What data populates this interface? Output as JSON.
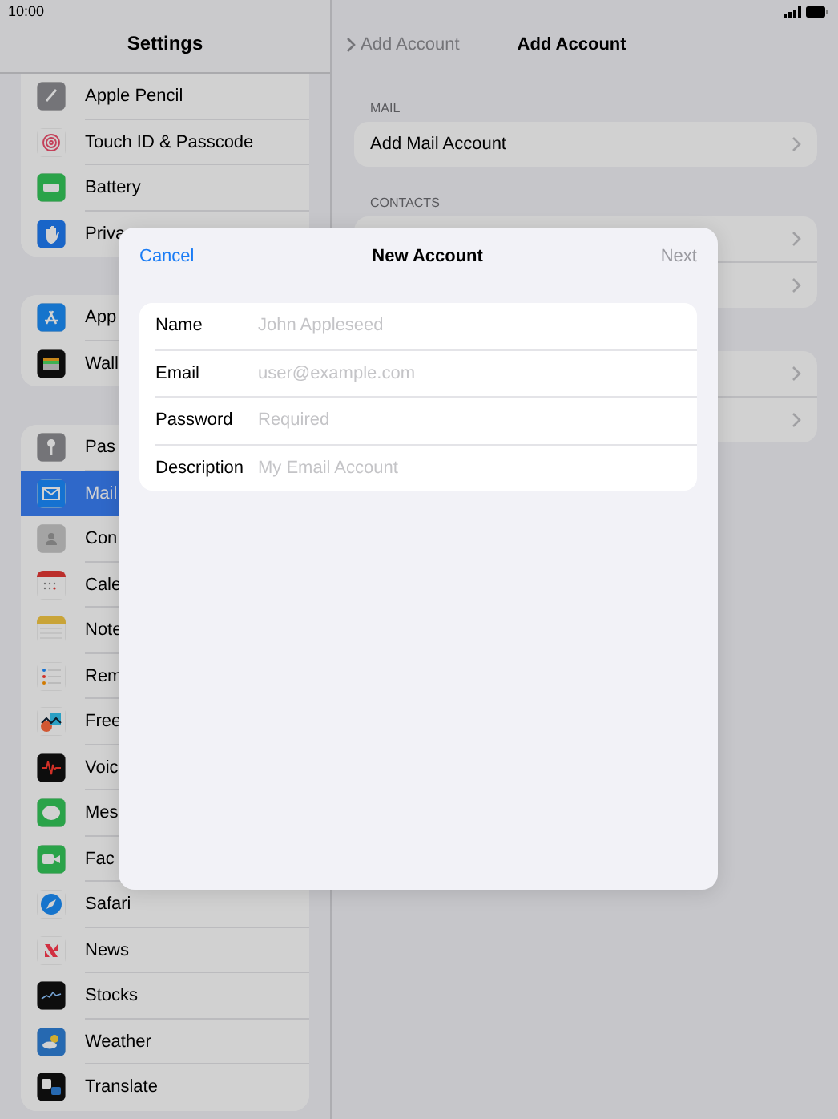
{
  "status_bar": {
    "time": "10:00"
  },
  "sidebar": {
    "title": "Settings",
    "groups": [
      {
        "items": [
          {
            "label": "Apple Pencil",
            "selected": false
          },
          {
            "label": "Touch ID & Passcode",
            "selected": false
          },
          {
            "label": "Battery",
            "selected": false
          },
          {
            "label": "Priva",
            "selected": false
          }
        ]
      },
      {
        "items": [
          {
            "label": "App",
            "selected": false
          },
          {
            "label": "Wall",
            "selected": false
          }
        ]
      },
      {
        "items": [
          {
            "label": "Pas",
            "selected": false
          },
          {
            "label": "Mail",
            "selected": true
          },
          {
            "label": "Con",
            "selected": false
          },
          {
            "label": "Cale",
            "selected": false
          },
          {
            "label": "Note",
            "selected": false
          },
          {
            "label": "Rem",
            "selected": false
          },
          {
            "label": "Free",
            "selected": false
          },
          {
            "label": "Voic",
            "selected": false
          },
          {
            "label": "Mes",
            "selected": false
          },
          {
            "label": "Fac",
            "selected": false
          },
          {
            "label": "Safari",
            "selected": false
          },
          {
            "label": "News",
            "selected": false
          },
          {
            "label": "Stocks",
            "selected": false
          },
          {
            "label": "Weather",
            "selected": false
          },
          {
            "label": "Translate",
            "selected": false
          }
        ]
      }
    ]
  },
  "detail": {
    "back": "Add Account",
    "title": "Add Account",
    "sections": [
      {
        "header": "MAIL",
        "rows": [
          {
            "kind": "link",
            "label": "Add Mail Account"
          }
        ]
      },
      {
        "header": "CONTACTS",
        "rows": [
          {
            "kind": "link"
          },
          {
            "kind": "link"
          }
        ]
      },
      {
        "rows": [
          {
            "kind": "link"
          },
          {
            "kind": "link"
          }
        ]
      }
    ]
  },
  "dialog": {
    "cancel": "Cancel",
    "title": "New Account",
    "next": {
      "label": "Next",
      "disabled": true
    },
    "fields": [
      {
        "label": "Name",
        "placeholder": "John Appleseed"
      },
      {
        "label": "Email",
        "placeholder": "user@example.com"
      },
      {
        "label": "Password",
        "placeholder": "Required"
      },
      {
        "label": "Description",
        "placeholder": "My Email Account"
      }
    ]
  }
}
